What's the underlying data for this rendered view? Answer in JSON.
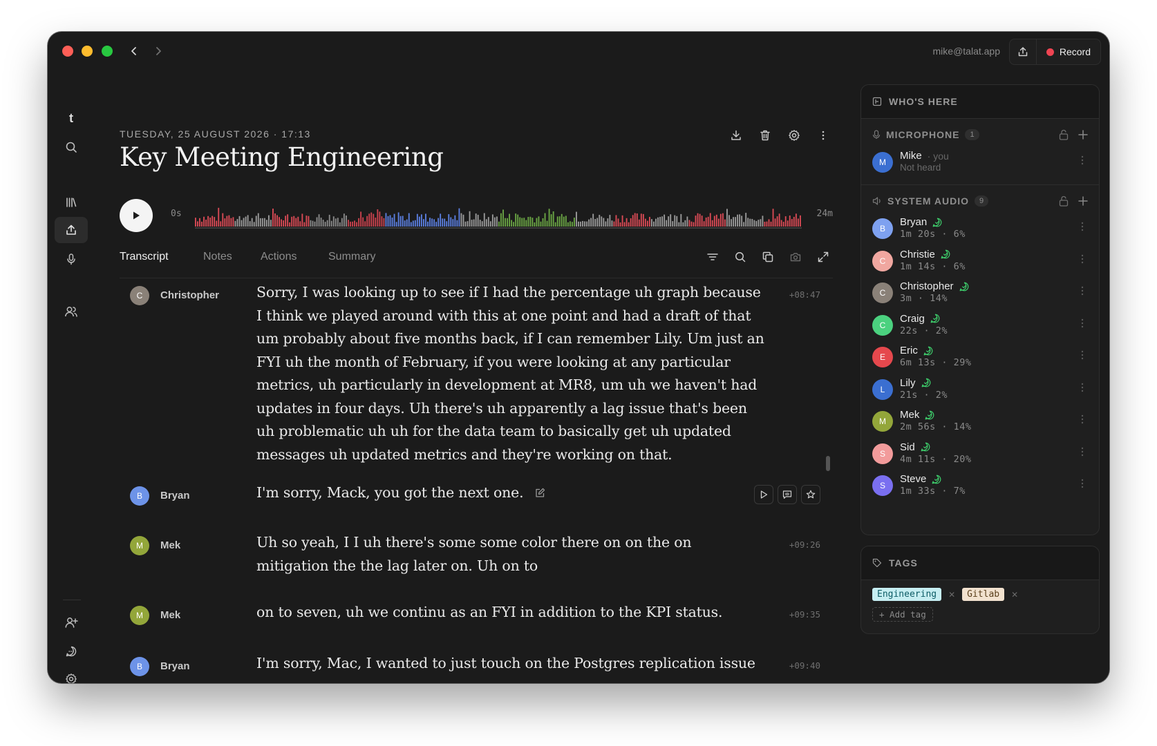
{
  "window": {
    "account": "mike@talat.app",
    "record_label": "Record"
  },
  "rail": {
    "logo": "t",
    "icons": [
      "search-icon",
      "library-icon",
      "upload-icon",
      "microphone-icon",
      "people-icon",
      "add-person-icon",
      "chat-icon",
      "gear-icon"
    ]
  },
  "meeting": {
    "date": "TUESDAY, 25 AUGUST 2026 · 17:13",
    "title": "Key Meeting Engineering",
    "time_start": "0s",
    "time_end": "24m"
  },
  "tabs": [
    {
      "label": "Transcript",
      "active": true
    },
    {
      "label": "Notes",
      "active": false
    },
    {
      "label": "Actions",
      "active": false
    },
    {
      "label": "Summary",
      "active": false
    }
  ],
  "transcript": [
    {
      "initial": "C",
      "speaker": "Christopher",
      "color": "#8a8178",
      "time": "+08:47",
      "text": "Sorry, I was looking up to see if I had the percentage uh graph because I think we played around with this at one point and had a draft of that um probably about five months back, if I can remember Lily. Um just an FYI uh the month of February, if you were looking at any particular metrics, uh particularly in development at MR8, um uh we haven't had updates in four days. Uh there's uh apparently a lag issue that's been uh problematic uh uh for the data team to basically get uh updated messages uh updated metrics and they're working on that."
    },
    {
      "initial": "B",
      "speaker": "Bryan",
      "color": "#6d93e8",
      "time": "",
      "text": "I'm sorry, Mack, you got the next one."
    },
    {
      "initial": "M",
      "speaker": "Mek",
      "color": "#93a63a",
      "time": "+09:26",
      "text": "Uh so yeah, I I uh there's some some color there on on the on mitigation the the lag later on. Uh on to"
    },
    {
      "initial": "M",
      "speaker": "Mek",
      "color": "#93a63a",
      "time": "+09:35",
      "text": "on to seven, uh we continu as an FYI in addition to the KPI status."
    },
    {
      "initial": "B",
      "speaker": "Bryan",
      "color": "#6d93e8",
      "time": "+09:40",
      "text": "I'm sorry, Mac, I wanted to just touch on the Postgres replication issue"
    }
  ],
  "panel": {
    "header": "WHO'S HERE",
    "microphone": {
      "label": "MICROPHONE",
      "count": "1",
      "people": [
        {
          "initial": "M",
          "name": "Mike",
          "you": "you",
          "sub": "Not heard",
          "color": "#3b6fd1"
        }
      ]
    },
    "system_audio": {
      "label": "SYSTEM AUDIO",
      "count": "9",
      "people": [
        {
          "initial": "B",
          "name": "Bryan",
          "sub": "1m 20s · 6%",
          "color": "#7ea1f0"
        },
        {
          "initial": "C",
          "name": "Christie",
          "sub": "1m 14s · 6%",
          "color": "#f0a7a0"
        },
        {
          "initial": "C",
          "name": "Christopher",
          "sub": "3m · 14%",
          "color": "#8a8178"
        },
        {
          "initial": "C",
          "name": "Craig",
          "sub": "22s · 2%",
          "color": "#4bd17f"
        },
        {
          "initial": "E",
          "name": "Eric",
          "sub": "6m 13s · 29%",
          "color": "#e5484d"
        },
        {
          "initial": "L",
          "name": "Lily",
          "sub": "21s · 2%",
          "color": "#3b6fd1"
        },
        {
          "initial": "M",
          "name": "Mek",
          "sub": "2m 56s · 14%",
          "color": "#93a63a"
        },
        {
          "initial": "S",
          "name": "Sid",
          "sub": "4m 11s · 20%",
          "color": "#f29b9b"
        },
        {
          "initial": "S",
          "name": "Steve",
          "sub": "1m 33s · 7%",
          "color": "#7a6ff0"
        }
      ]
    }
  },
  "tags": {
    "header": "TAGS",
    "items": [
      {
        "label": "Engineering",
        "bg": "#c6eef2",
        "fg": "#0d5c66"
      },
      {
        "label": "Gitlab",
        "bg": "#f2e2cf",
        "fg": "#5a3e1a"
      }
    ],
    "add_label": "+ Add tag"
  },
  "colors": {
    "verified": "#3ecf6c",
    "record": "#ef4452"
  }
}
